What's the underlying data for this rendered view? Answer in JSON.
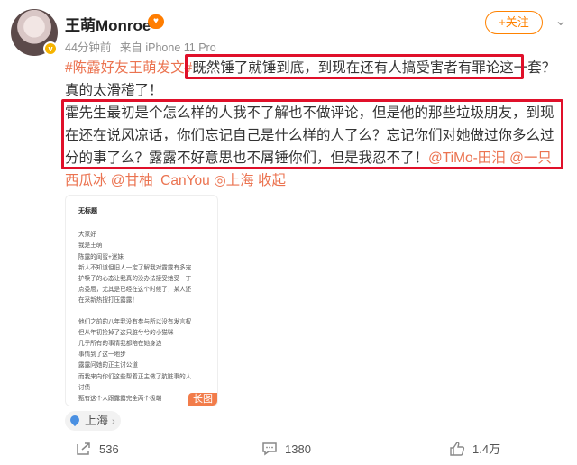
{
  "author": {
    "name": "王萌Monroe",
    "vip_badge": "♥",
    "verified_badge": "v",
    "avatar": "avatar-photo"
  },
  "meta": {
    "time": "44分钟前",
    "source": "来自 iPhone 11 Pro"
  },
  "follow_button": "+关注",
  "more": "⌄",
  "post": {
    "hashtag": "#陈露好友王萌发文#",
    "seg1": "既然锤了就锤到底，到现在还有人搞受害者有罪论这一套？",
    "seg2": "真的太滑稽了！",
    "seg3": "霍先生最初是个怎么样的人我不了解也不做评论，但是他的那些垃圾朋友，到现在还在说风凉话，你们忘记自己是什么样的人了么？忘记你们对她做过你多么过分的事了么？露露不好意思也不屑锤你们，但是我忍不了！",
    "mention1": "@TiMo-田汨",
    "mention2": "@一只西瓜冰",
    "mention3": "@甘柚_CanYou",
    "location": "上海",
    "collapse": "收起"
  },
  "image_card": {
    "title": "无标题",
    "lines": [
      "大家好",
      "我是王萌",
      "陈露的闺蜜+迷妹",
      "新人不知道但旧人一定了解我对露露有多宠",
      "护犊子的心态让我真的没办法接受她受一丁",
      "点委屈，尤其是已经在这个时候了，某人还",
      "在采新热搜打压露露！",
      "",
      "他们之前的八年我没有参与所以没有发言权",
      "但从年初捡掉了这只脏兮兮的小猫咪",
      "几乎所有的事情我都陪在她身边",
      "事情到了这一地步",
      "露露问她的正主讨公道",
      "而我来向你们这些帮着正主做了肮脏事的人",
      "讨债",
      "甄有这个人跟露露完全两个极端"
    ],
    "badge": "长图"
  },
  "location_chip": {
    "label": "上海"
  },
  "actions": {
    "forward": "536",
    "comment": "1380",
    "like": "1.4万"
  },
  "colors": {
    "accent": "#ff8200",
    "link": "#eb7350",
    "highlight": "#e0102a"
  }
}
